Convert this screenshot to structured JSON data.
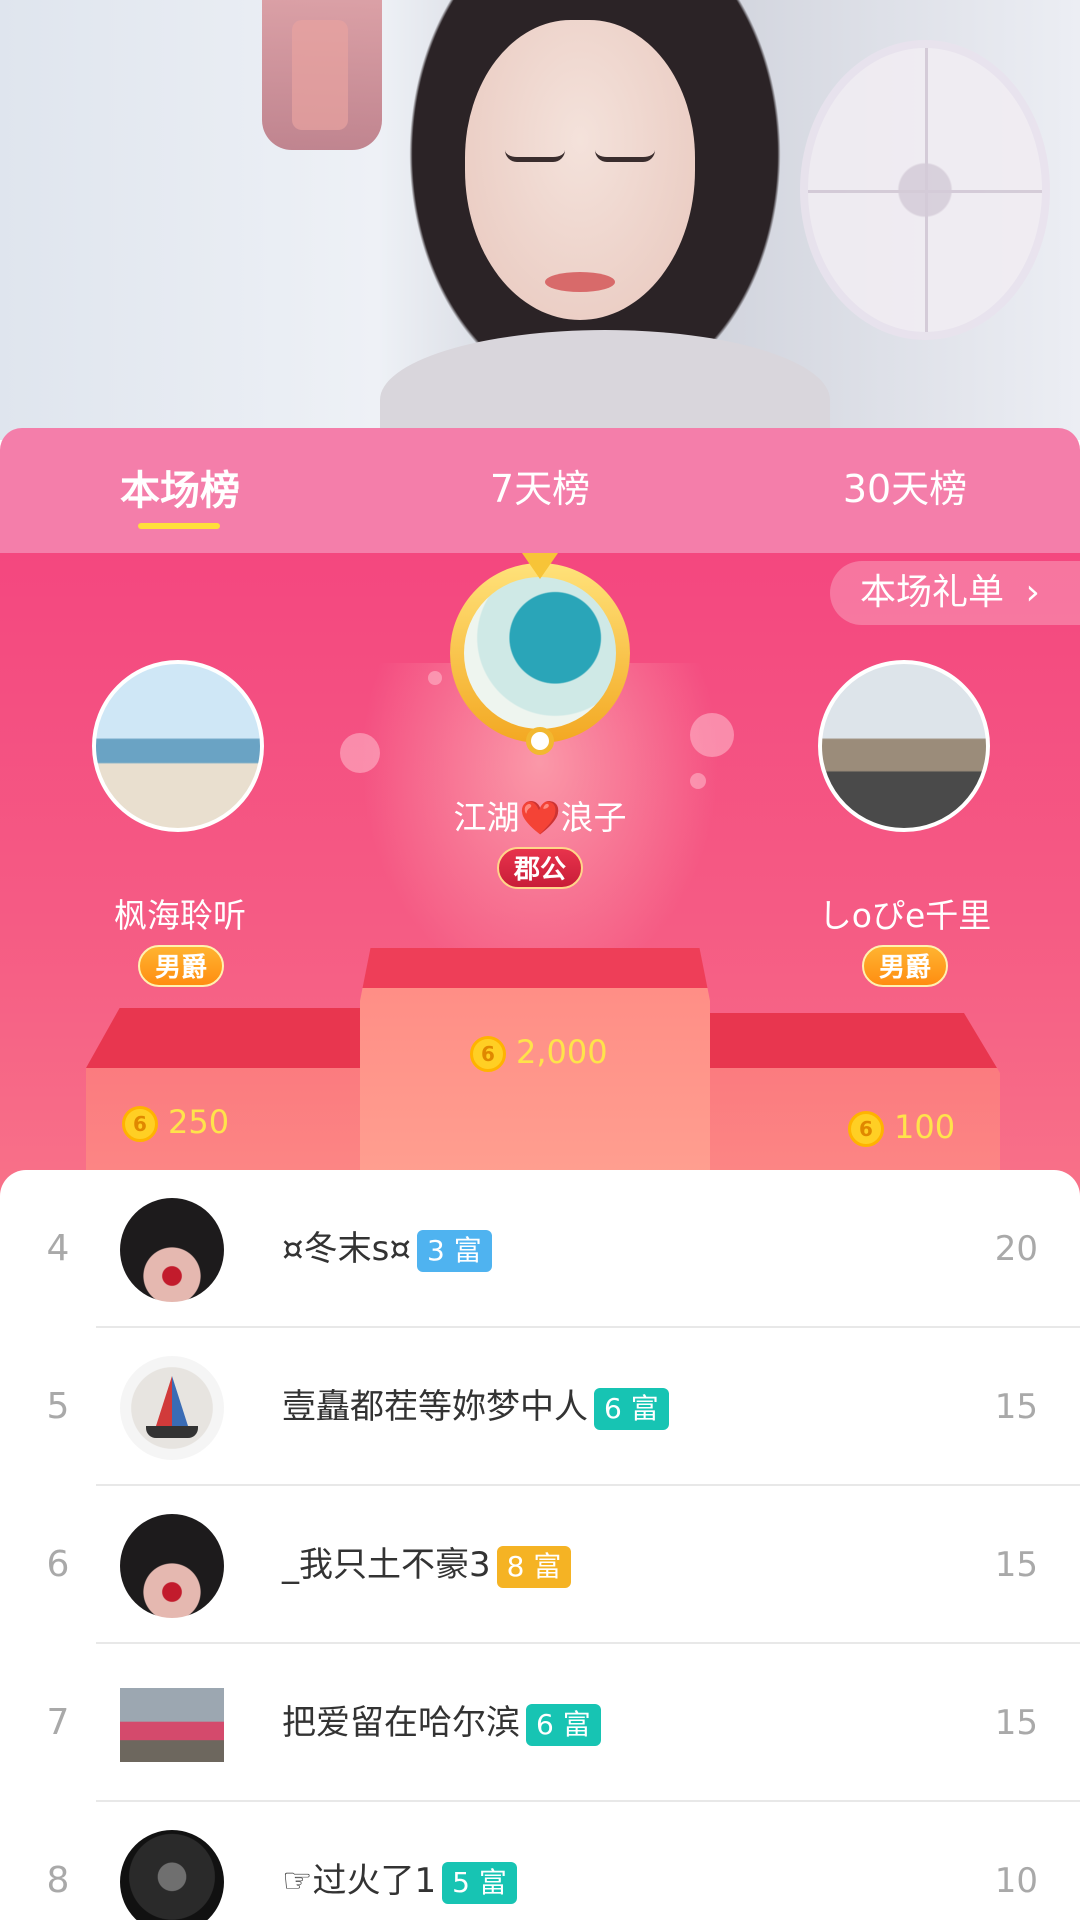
{
  "tabs": [
    {
      "label": "本场榜",
      "active": true
    },
    {
      "label": "7天榜",
      "active": false
    },
    {
      "label": "30天榜",
      "active": false
    }
  ],
  "gift_link": {
    "label": "本场礼单",
    "chevron": "›"
  },
  "podium": {
    "first": {
      "rank": "1",
      "name": "江湖❤️浪子",
      "title": "郡公",
      "amount": "2,000"
    },
    "second": {
      "rank": "2",
      "name": "枫海聆听",
      "title": "男爵",
      "amount": "250"
    },
    "third": {
      "rank": "3",
      "name": "しoぴe千里",
      "title": "男爵",
      "amount": "100"
    }
  },
  "coin_glyph": "6",
  "ranking_list": [
    {
      "rank": "4",
      "name": "¤冬末s¤",
      "level": "3 富",
      "level_color": "#4fb3f0",
      "score": "20"
    },
    {
      "rank": "5",
      "name": "壹矗都茬等妳梦中人",
      "level": "6 富",
      "level_color": "#17c4b3",
      "score": "15"
    },
    {
      "rank": "6",
      "name": "_我只土不豪3",
      "level": "8 富",
      "level_color": "#f5b324",
      "score": "15"
    },
    {
      "rank": "7",
      "name": "把爱留在哈尔滨",
      "level": "6 富",
      "level_color": "#17c4b3",
      "score": "15"
    },
    {
      "rank": "8",
      "name": "☞过火了1",
      "level": "5 富",
      "level_color": "#17c4b3",
      "score": "10"
    }
  ]
}
